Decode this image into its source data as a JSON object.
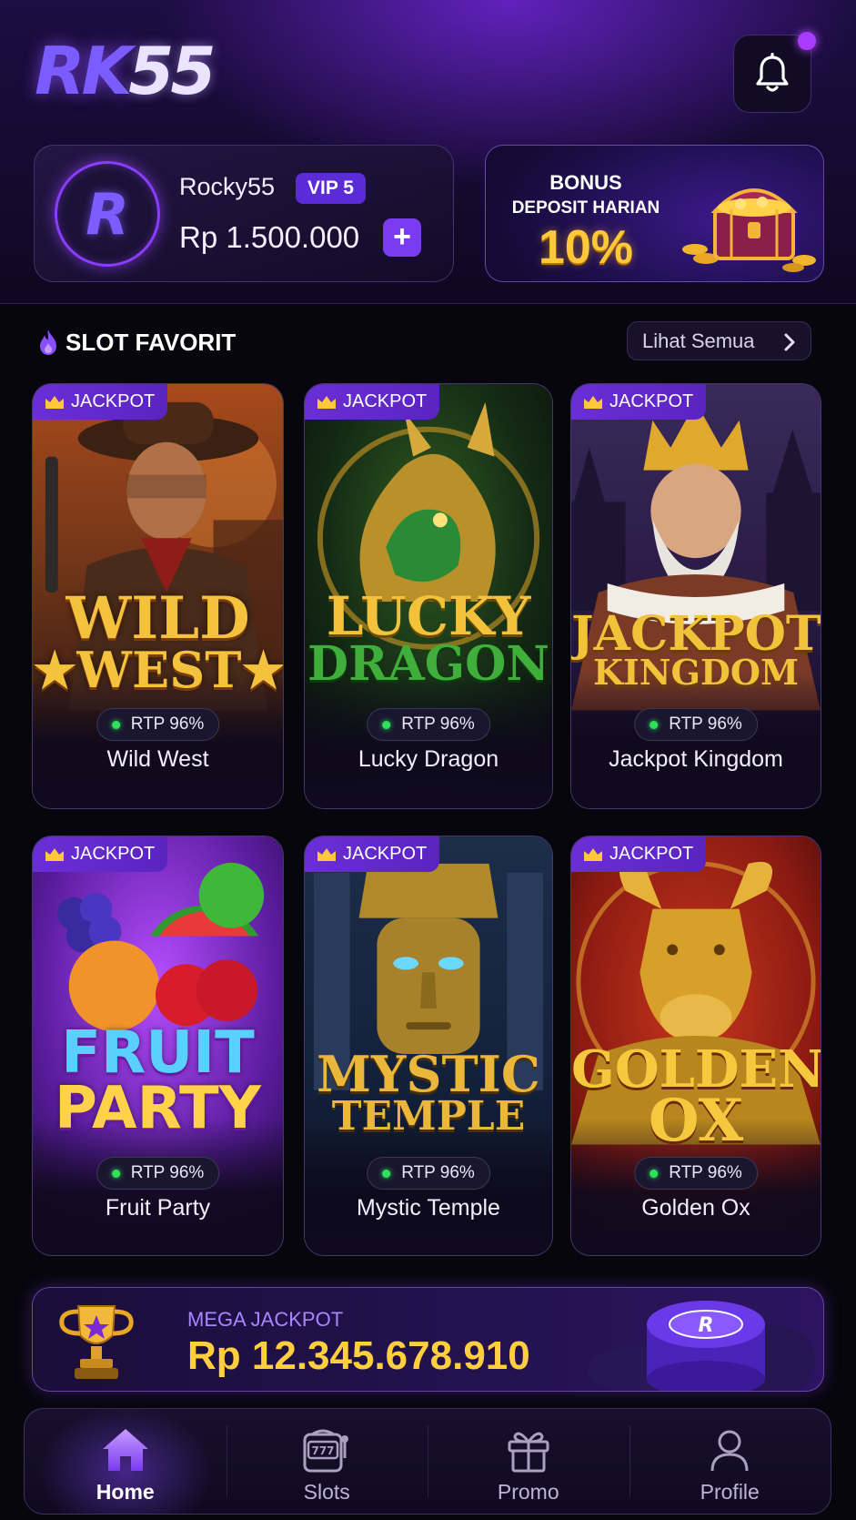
{
  "app": {
    "logo_text_a": "RK",
    "logo_text_b": "55"
  },
  "header": {
    "notification_icon": "bell-icon",
    "has_unread": true
  },
  "user": {
    "avatar_letter": "R",
    "name": "Rocky55",
    "vip": "VIP 5",
    "balance": "Rp 1.500.000",
    "add_button": "+"
  },
  "bonus": {
    "title": "BONUS",
    "subtitle": "DEPOSIT HARIAN",
    "percent": "10%"
  },
  "slots": {
    "section_title": "SLOT FAVORIT",
    "see_all": "Lihat Semua",
    "games": [
      {
        "badge": "JACKPOT",
        "art_line1": "WILD",
        "art_line2": "★WEST★",
        "rtp": "RTP 96%",
        "name": "Wild West"
      },
      {
        "badge": "JACKPOT",
        "art_line1": "LUCKY",
        "art_line2": "DRAGON",
        "rtp": "RTP 96%",
        "name": "Lucky Dragon"
      },
      {
        "badge": "JACKPOT",
        "art_line1": "JACKPOT",
        "art_line2": "KINGDOM",
        "rtp": "RTP 96%",
        "name": "Jackpot Kingdom"
      },
      {
        "badge": "JACKPOT",
        "art_line1": "FRUIT",
        "art_line2": "PARTY",
        "rtp": "RTP 96%",
        "name": "Fruit Party"
      },
      {
        "badge": "JACKPOT",
        "art_line1": "MYSTIC",
        "art_line2": "TEMPLE",
        "rtp": "RTP 96%",
        "name": "Mystic Temple"
      },
      {
        "badge": "JACKPOT",
        "art_line1": "GOLDEN",
        "art_line2": "OX",
        "rtp": "RTP 96%",
        "name": "Golden Ox"
      }
    ]
  },
  "mega_jackpot": {
    "label": "MEGA JACKPOT",
    "value": "Rp 12.345.678.910"
  },
  "nav": {
    "items": [
      {
        "label": "Home",
        "icon": "home-icon",
        "active": true
      },
      {
        "label": "Slots",
        "icon": "slot-machine-icon",
        "active": false
      },
      {
        "label": "Promo",
        "icon": "gift-icon",
        "active": false
      },
      {
        "label": "Profile",
        "icon": "user-icon",
        "active": false
      }
    ]
  },
  "colors": {
    "accent": "#7b3cf0",
    "gold": "#ffc83a",
    "rtp_dot": "#2fe05a",
    "background": "#07060d"
  }
}
